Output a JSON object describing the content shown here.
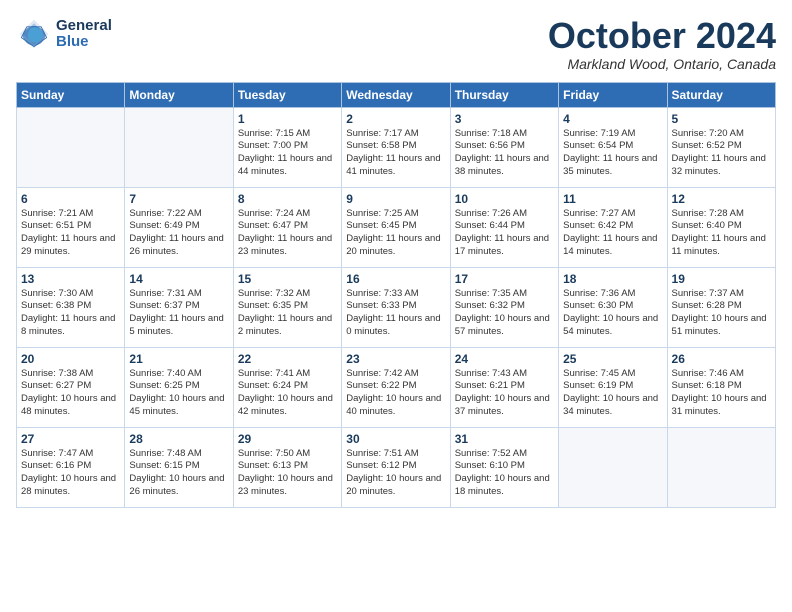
{
  "header": {
    "logo_line1": "General",
    "logo_line2": "Blue",
    "month_title": "October 2024",
    "location": "Markland Wood, Ontario, Canada"
  },
  "weekdays": [
    "Sunday",
    "Monday",
    "Tuesday",
    "Wednesday",
    "Thursday",
    "Friday",
    "Saturday"
  ],
  "weeks": [
    [
      {
        "day": "",
        "info": ""
      },
      {
        "day": "",
        "info": ""
      },
      {
        "day": "1",
        "info": "Sunrise: 7:15 AM\nSunset: 7:00 PM\nDaylight: 11 hours and 44 minutes."
      },
      {
        "day": "2",
        "info": "Sunrise: 7:17 AM\nSunset: 6:58 PM\nDaylight: 11 hours and 41 minutes."
      },
      {
        "day": "3",
        "info": "Sunrise: 7:18 AM\nSunset: 6:56 PM\nDaylight: 11 hours and 38 minutes."
      },
      {
        "day": "4",
        "info": "Sunrise: 7:19 AM\nSunset: 6:54 PM\nDaylight: 11 hours and 35 minutes."
      },
      {
        "day": "5",
        "info": "Sunrise: 7:20 AM\nSunset: 6:52 PM\nDaylight: 11 hours and 32 minutes."
      }
    ],
    [
      {
        "day": "6",
        "info": "Sunrise: 7:21 AM\nSunset: 6:51 PM\nDaylight: 11 hours and 29 minutes."
      },
      {
        "day": "7",
        "info": "Sunrise: 7:22 AM\nSunset: 6:49 PM\nDaylight: 11 hours and 26 minutes."
      },
      {
        "day": "8",
        "info": "Sunrise: 7:24 AM\nSunset: 6:47 PM\nDaylight: 11 hours and 23 minutes."
      },
      {
        "day": "9",
        "info": "Sunrise: 7:25 AM\nSunset: 6:45 PM\nDaylight: 11 hours and 20 minutes."
      },
      {
        "day": "10",
        "info": "Sunrise: 7:26 AM\nSunset: 6:44 PM\nDaylight: 11 hours and 17 minutes."
      },
      {
        "day": "11",
        "info": "Sunrise: 7:27 AM\nSunset: 6:42 PM\nDaylight: 11 hours and 14 minutes."
      },
      {
        "day": "12",
        "info": "Sunrise: 7:28 AM\nSunset: 6:40 PM\nDaylight: 11 hours and 11 minutes."
      }
    ],
    [
      {
        "day": "13",
        "info": "Sunrise: 7:30 AM\nSunset: 6:38 PM\nDaylight: 11 hours and 8 minutes."
      },
      {
        "day": "14",
        "info": "Sunrise: 7:31 AM\nSunset: 6:37 PM\nDaylight: 11 hours and 5 minutes."
      },
      {
        "day": "15",
        "info": "Sunrise: 7:32 AM\nSunset: 6:35 PM\nDaylight: 11 hours and 2 minutes."
      },
      {
        "day": "16",
        "info": "Sunrise: 7:33 AM\nSunset: 6:33 PM\nDaylight: 11 hours and 0 minutes."
      },
      {
        "day": "17",
        "info": "Sunrise: 7:35 AM\nSunset: 6:32 PM\nDaylight: 10 hours and 57 minutes."
      },
      {
        "day": "18",
        "info": "Sunrise: 7:36 AM\nSunset: 6:30 PM\nDaylight: 10 hours and 54 minutes."
      },
      {
        "day": "19",
        "info": "Sunrise: 7:37 AM\nSunset: 6:28 PM\nDaylight: 10 hours and 51 minutes."
      }
    ],
    [
      {
        "day": "20",
        "info": "Sunrise: 7:38 AM\nSunset: 6:27 PM\nDaylight: 10 hours and 48 minutes."
      },
      {
        "day": "21",
        "info": "Sunrise: 7:40 AM\nSunset: 6:25 PM\nDaylight: 10 hours and 45 minutes."
      },
      {
        "day": "22",
        "info": "Sunrise: 7:41 AM\nSunset: 6:24 PM\nDaylight: 10 hours and 42 minutes."
      },
      {
        "day": "23",
        "info": "Sunrise: 7:42 AM\nSunset: 6:22 PM\nDaylight: 10 hours and 40 minutes."
      },
      {
        "day": "24",
        "info": "Sunrise: 7:43 AM\nSunset: 6:21 PM\nDaylight: 10 hours and 37 minutes."
      },
      {
        "day": "25",
        "info": "Sunrise: 7:45 AM\nSunset: 6:19 PM\nDaylight: 10 hours and 34 minutes."
      },
      {
        "day": "26",
        "info": "Sunrise: 7:46 AM\nSunset: 6:18 PM\nDaylight: 10 hours and 31 minutes."
      }
    ],
    [
      {
        "day": "27",
        "info": "Sunrise: 7:47 AM\nSunset: 6:16 PM\nDaylight: 10 hours and 28 minutes."
      },
      {
        "day": "28",
        "info": "Sunrise: 7:48 AM\nSunset: 6:15 PM\nDaylight: 10 hours and 26 minutes."
      },
      {
        "day": "29",
        "info": "Sunrise: 7:50 AM\nSunset: 6:13 PM\nDaylight: 10 hours and 23 minutes."
      },
      {
        "day": "30",
        "info": "Sunrise: 7:51 AM\nSunset: 6:12 PM\nDaylight: 10 hours and 20 minutes."
      },
      {
        "day": "31",
        "info": "Sunrise: 7:52 AM\nSunset: 6:10 PM\nDaylight: 10 hours and 18 minutes."
      },
      {
        "day": "",
        "info": ""
      },
      {
        "day": "",
        "info": ""
      }
    ]
  ]
}
